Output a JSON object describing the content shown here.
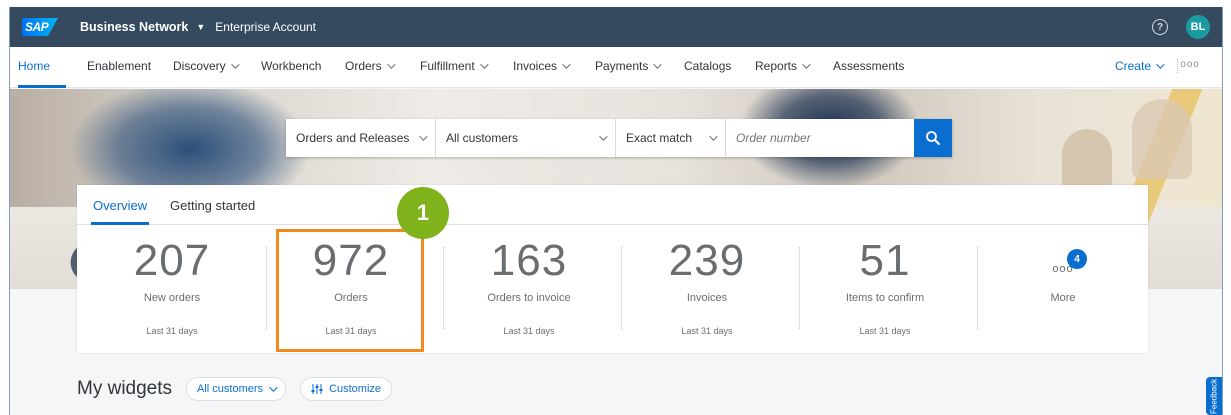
{
  "shell": {
    "logo": "SAP",
    "product": "Business Network",
    "account": "Enterprise Account",
    "help_icon": "?",
    "avatar_initials": "BL"
  },
  "nav": {
    "items": [
      {
        "label": "Home",
        "has_menu": false
      },
      {
        "label": "Enablement",
        "has_menu": false
      },
      {
        "label": "Discovery",
        "has_menu": true
      },
      {
        "label": "Workbench",
        "has_menu": false
      },
      {
        "label": "Orders",
        "has_menu": true
      },
      {
        "label": "Fulfillment",
        "has_menu": true
      },
      {
        "label": "Invoices",
        "has_menu": true
      },
      {
        "label": "Payments",
        "has_menu": true
      },
      {
        "label": "Catalogs",
        "has_menu": false
      },
      {
        "label": "Reports",
        "has_menu": true
      },
      {
        "label": "Assessments",
        "has_menu": false
      }
    ],
    "create_label": "Create",
    "more_label": "ooo"
  },
  "search": {
    "type": "Orders and Releases",
    "customer": "All customers",
    "match": "Exact match",
    "placeholder": "Order number"
  },
  "overview": {
    "tabs": [
      "Overview",
      "Getting started"
    ],
    "tiles": [
      {
        "value": "207",
        "label": "New orders",
        "period": "Last 31 days"
      },
      {
        "value": "972",
        "label": "Orders",
        "period": "Last 31 days"
      },
      {
        "value": "163",
        "label": "Orders to invoice",
        "period": "Last 31 days"
      },
      {
        "value": "239",
        "label": "Invoices",
        "period": "Last 31 days"
      },
      {
        "value": "51",
        "label": "Items to confirm",
        "period": "Last 31 days"
      }
    ],
    "more": {
      "label": "More",
      "badge": "4",
      "dots": "ooo"
    }
  },
  "callout": {
    "step": "1"
  },
  "widgets": {
    "title": "My widgets",
    "filter_label": "All customers",
    "customize_label": "Customize"
  },
  "feedback_label": "Feedback",
  "colors": {
    "shell_bg": "#354a5f",
    "accent": "#0a6ed1",
    "highlight": "#f08a1c",
    "step_badge": "#7fb21b"
  }
}
